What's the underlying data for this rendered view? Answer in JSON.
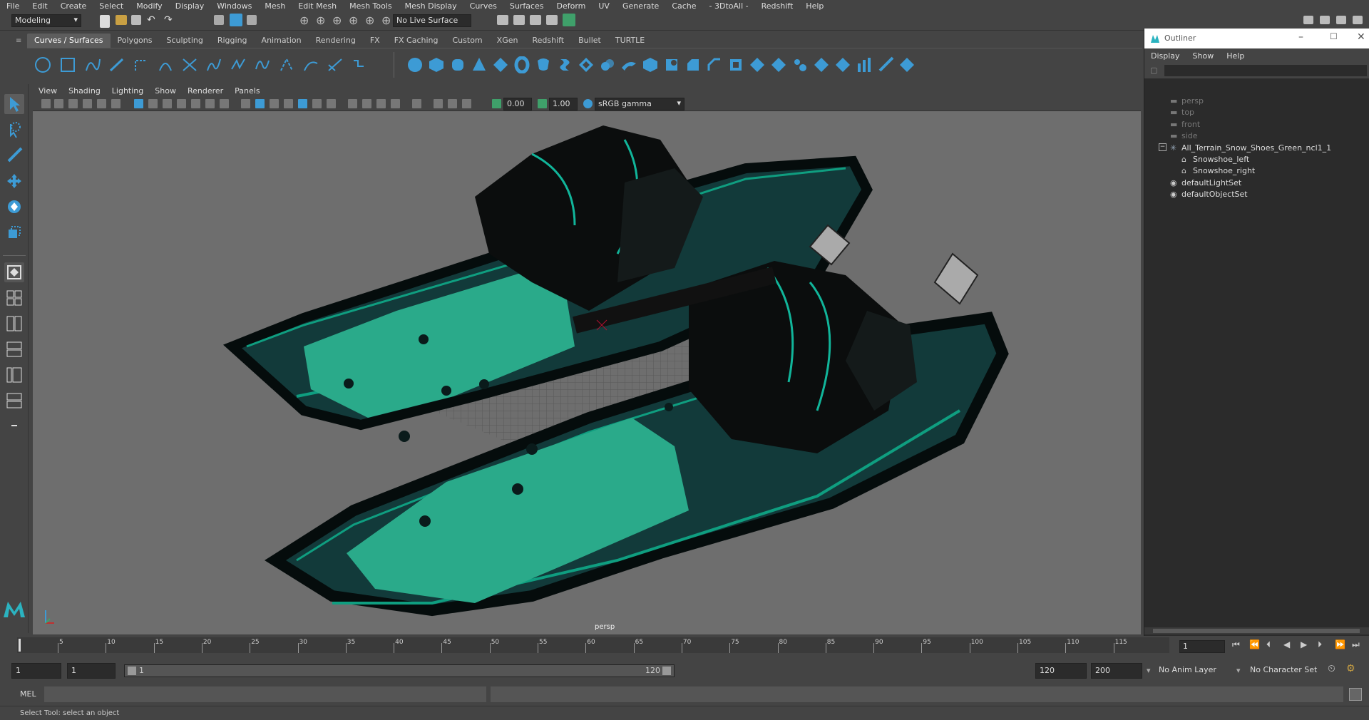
{
  "menubar": [
    "File",
    "Edit",
    "Create",
    "Select",
    "Modify",
    "Display",
    "Windows",
    "Mesh",
    "Edit Mesh",
    "Mesh Tools",
    "Mesh Display",
    "Curves",
    "Surfaces",
    "Deform",
    "UV",
    "Generate",
    "Cache",
    "- 3DtoAll -",
    "Redshift",
    "Help"
  ],
  "status": {
    "workspace": "Modeling",
    "live_surface": "No Live Surface"
  },
  "shelf_tabs": [
    "Curves / Surfaces",
    "Polygons",
    "Sculpting",
    "Rigging",
    "Animation",
    "Rendering",
    "FX",
    "FX Caching",
    "Custom",
    "XGen",
    "Redshift",
    "Bullet",
    "TURTLE"
  ],
  "panel_menu": [
    "View",
    "Shading",
    "Lighting",
    "Show",
    "Renderer",
    "Panels"
  ],
  "panel_toolbar": {
    "exposure": "0.00",
    "gamma": "1.00",
    "colorspace": "sRGB gamma"
  },
  "viewport": {
    "camera_label": "persp"
  },
  "outliner": {
    "title": "Outliner",
    "menu": [
      "Display",
      "Show",
      "Help"
    ],
    "items": [
      {
        "label": "persp",
        "type": "camera",
        "indent": 0
      },
      {
        "label": "top",
        "type": "camera",
        "indent": 0
      },
      {
        "label": "front",
        "type": "camera",
        "indent": 0
      },
      {
        "label": "side",
        "type": "camera",
        "indent": 0
      },
      {
        "label": "All_Terrain_Snow_Shoes_Green_ncl1_1",
        "type": "group",
        "indent": 0
      },
      {
        "label": "Snowshoe_left",
        "type": "mesh",
        "indent": 1
      },
      {
        "label": "Snowshoe_right",
        "type": "mesh",
        "indent": 1
      },
      {
        "label": "defaultLightSet",
        "type": "set",
        "indent": 0
      },
      {
        "label": "defaultObjectSet",
        "type": "set",
        "indent": 0
      }
    ]
  },
  "timeline": {
    "ticks": [
      "5",
      "10",
      "15",
      "20",
      "25",
      "30",
      "35",
      "40",
      "45",
      "50",
      "55",
      "60",
      "65",
      "70",
      "75",
      "80",
      "85",
      "90",
      "95",
      "100",
      "105",
      "110",
      "115"
    ],
    "current_frame": "1"
  },
  "range": {
    "start": "1",
    "anim_start": "1",
    "slider_start": "1",
    "slider_end": "120",
    "end": "120",
    "anim_end": "200",
    "anim_layer": "No Anim Layer",
    "char_set": "No Character Set"
  },
  "command": {
    "label": "MEL"
  },
  "help_line": "Select Tool: select an object",
  "colors": {
    "accent": "#2e9e8f",
    "selected_tab": "#5d5d5d",
    "icon_blue": "#3d9bd5"
  }
}
